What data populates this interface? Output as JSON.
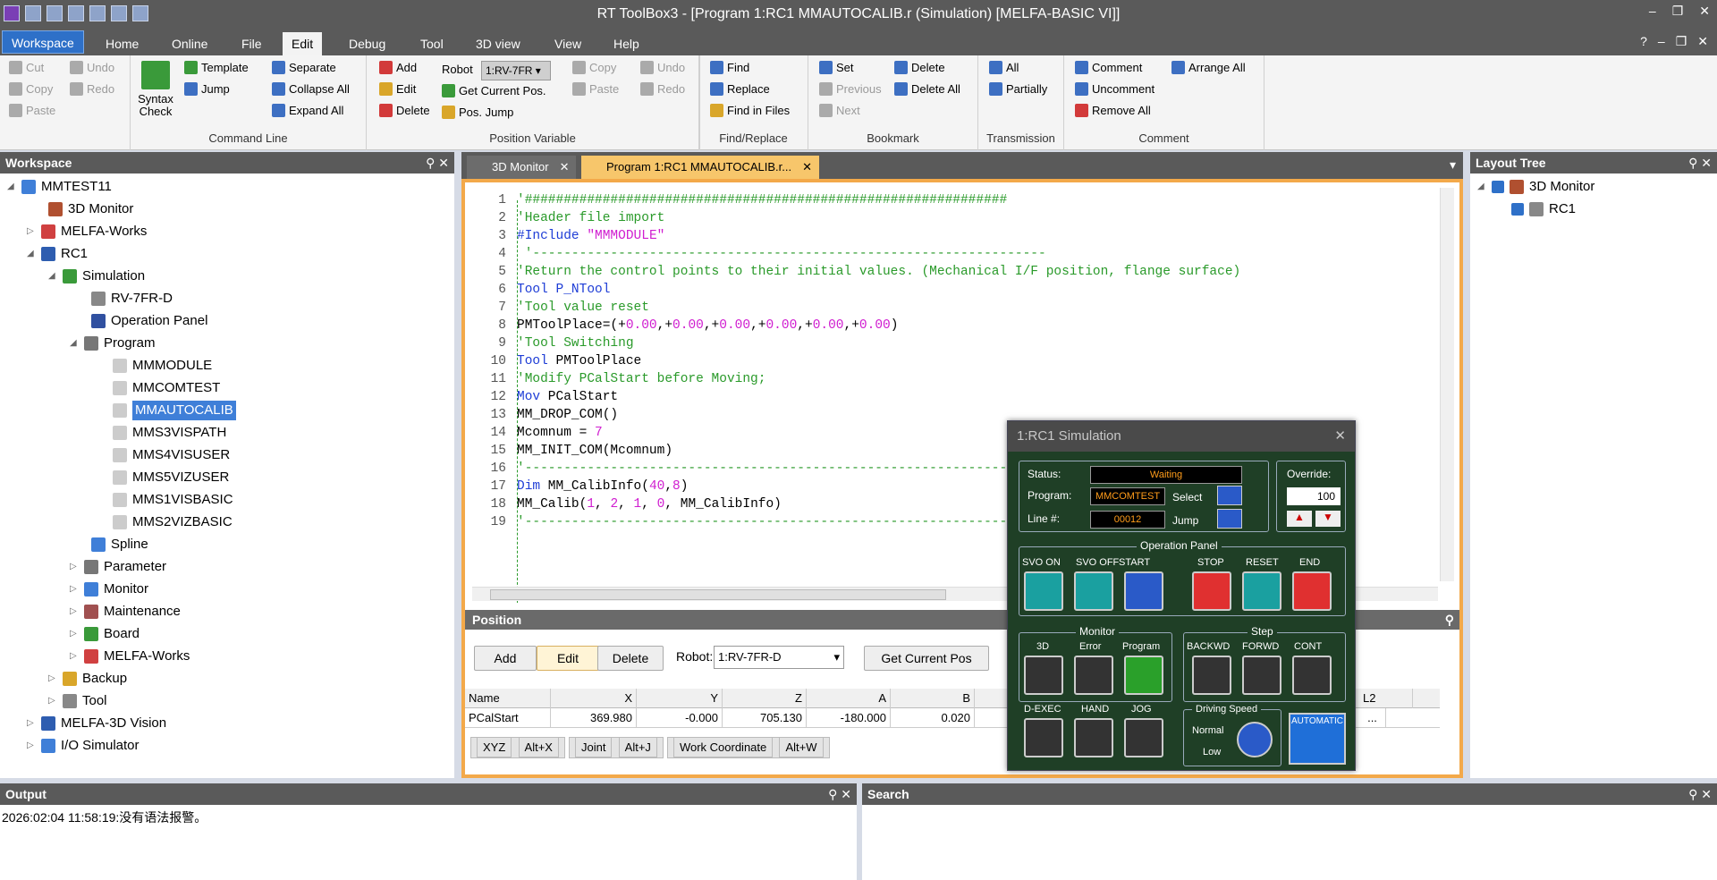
{
  "window": {
    "title": "RT ToolBox3 - [Program 1:RC1 MMAUTOCALIB.r (Simulation)   [MELFA-BASIC VI]]"
  },
  "menu": {
    "tabs": [
      "Workspace",
      "Home",
      "Online",
      "File",
      "Edit",
      "Debug",
      "Tool",
      "3D view",
      "View",
      "Help"
    ],
    "active": "Edit"
  },
  "ribbon": {
    "clipboard": {
      "cut": "Cut",
      "copy": "Copy",
      "paste": "Paste",
      "undo": "Undo",
      "redo": "Redo"
    },
    "command_line": {
      "label": "Command Line",
      "syntax_check": "Syntax Check",
      "template": "Template",
      "jump": "Jump",
      "separate": "Separate",
      "collapse_all": "Collapse All",
      "expand_all": "Expand All"
    },
    "position_variable": {
      "label": "Position Variable",
      "add": "Add",
      "edit": "Edit",
      "delete": "Delete",
      "robot_label": "Robot",
      "robot_value": "1:RV-7FR",
      "get_current_pos": "Get Current Pos.",
      "pos_jump": "Pos. Jump"
    },
    "edit2": {
      "copy": "Copy",
      "paste": "Paste",
      "undo": "Undo",
      "redo": "Redo"
    },
    "find_replace": {
      "label": "Find/Replace",
      "find": "Find",
      "replace": "Replace",
      "find_in_files": "Find in Files"
    },
    "bookmark": {
      "label": "Bookmark",
      "set": "Set",
      "previous": "Previous",
      "next": "Next",
      "delete": "Delete",
      "delete_all": "Delete All"
    },
    "transmission": {
      "label": "Transmission",
      "all": "All",
      "partially": "Partially"
    },
    "comment": {
      "label": "Comment",
      "comment": "Comment",
      "uncomment": "Uncomment",
      "remove_all": "Remove All",
      "arrange_all": "Arrange All"
    }
  },
  "workspace": {
    "title": "Workspace",
    "tree": [
      {
        "label": "MMTEST11"
      },
      {
        "label": "3D Monitor"
      },
      {
        "label": "MELFA-Works"
      },
      {
        "label": "RC1"
      },
      {
        "label": "Simulation"
      },
      {
        "label": "RV-7FR-D"
      },
      {
        "label": "Operation Panel"
      },
      {
        "label": "Program"
      },
      {
        "label": "MMMODULE"
      },
      {
        "label": "MMCOMTEST"
      },
      {
        "label": "MMAUTOCALIB"
      },
      {
        "label": "MMS3VISPATH"
      },
      {
        "label": "MMS4VISUSER"
      },
      {
        "label": "MMS5VIZUSER"
      },
      {
        "label": "MMS1VISBASIC"
      },
      {
        "label": "MMS2VIZBASIC"
      },
      {
        "label": "Spline"
      },
      {
        "label": "Parameter"
      },
      {
        "label": "Monitor"
      },
      {
        "label": "Maintenance"
      },
      {
        "label": "Board"
      },
      {
        "label": "MELFA-Works"
      },
      {
        "label": "Backup"
      },
      {
        "label": "Tool"
      },
      {
        "label": "MELFA-3D Vision"
      },
      {
        "label": "I/O Simulator"
      }
    ]
  },
  "doc_tabs": [
    {
      "label": "3D Monitor"
    },
    {
      "label": "Program 1:RC1 MMAUTOCALIB.r..."
    }
  ],
  "code": {
    "line_numbers": [
      "1",
      "2",
      "3",
      "4",
      "5",
      "6",
      "7",
      "8",
      "9",
      "10",
      "11",
      "12",
      "13",
      "14",
      "15",
      "16",
      "17",
      "18",
      "19"
    ]
  },
  "position": {
    "title": "Position",
    "add": "Add",
    "edit": "Edit",
    "delete": "Delete",
    "robot_label": "Robot:",
    "robot_value": "1:RV-7FR-D",
    "get_current_pos": "Get Current Pos",
    "columns": [
      "Name",
      "X",
      "Y",
      "Z",
      "A",
      "B"
    ],
    "rows": [
      [
        "PCalStart",
        "369.980",
        "-0.000",
        "705.130",
        "-180.000",
        "0.020"
      ]
    ],
    "extra_col": "L2",
    "tabs": [
      "XYZ",
      "Alt+X",
      "Joint",
      "Alt+J",
      "Work Coordinate",
      "Alt+W"
    ]
  },
  "layout_tree": {
    "title": "Layout Tree",
    "items": [
      "3D Monitor",
      "RC1"
    ]
  },
  "output": {
    "title": "Output",
    "line": "2026:02:04 11:58:19:没有语法报警。"
  },
  "search": {
    "title": "Search"
  },
  "sim": {
    "title": "1:RC1  Simulation",
    "status_label": "Status:",
    "status_value": "Waiting",
    "program_label": "Program:",
    "program_value": "MMCOMTEST",
    "select_label": "Select",
    "line_label": "Line #:",
    "line_value": "00012",
    "jump_label": "Jump",
    "override_label": "Override:",
    "override_value": "100",
    "operation_panel": "Operation Panel",
    "svo_on": "SVO ON",
    "svo_off": "SVO OFF",
    "start": "START",
    "stop": "STOP",
    "reset": "RESET",
    "end": "END",
    "monitor": "Monitor",
    "mon_3d": "3D",
    "mon_error": "Error",
    "mon_program": "Program",
    "step": "Step",
    "backwd": "BACKWD",
    "forwd": "FORWD",
    "cont": "CONT",
    "dexec": "D-EXEC",
    "hand": "HAND",
    "jog": "JOG",
    "driving_speed": "Driving Speed",
    "normal": "Normal",
    "low": "Low",
    "automatic": "AUTOMATIC"
  }
}
